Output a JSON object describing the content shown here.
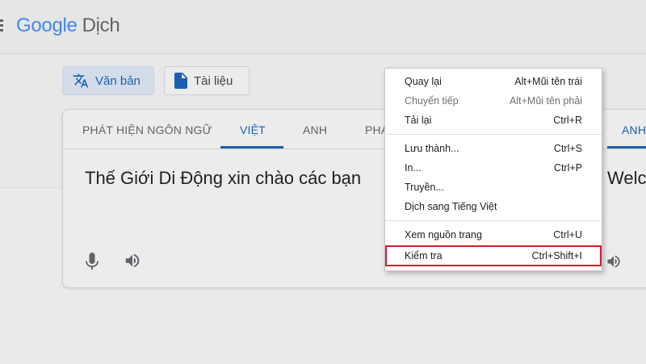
{
  "header": {
    "logo_google": "Google",
    "logo_product": "Dịch"
  },
  "modes": {
    "text_label": "Văn bản",
    "doc_label": "Tài liệu"
  },
  "source_langs": [
    "PHÁT HIỆN NGÔN NGỮ",
    "VIỆT",
    "ANH",
    "PHÁ"
  ],
  "target_lang_partial": "ANH",
  "source_text": "Thế Giới Di Động xin chào các bạn",
  "target_text_partial": "Welc",
  "context_menu": {
    "items": [
      {
        "label": "Quay lại",
        "shortcut": "Alt+Mũi tên trái"
      },
      {
        "label": "Chuyển tiếp",
        "shortcut": "Alt+Mũi tên phải"
      },
      {
        "label": "Tải lại",
        "shortcut": "Ctrl+R"
      },
      {
        "label": "Lưu thành...",
        "shortcut": "Ctrl+S"
      },
      {
        "label": "In...",
        "shortcut": "Ctrl+P"
      },
      {
        "label": "Truyền...",
        "shortcut": ""
      },
      {
        "label": "Dịch sang Tiếng Việt",
        "shortcut": ""
      },
      {
        "label": "Xem nguồn trang",
        "shortcut": "Ctrl+U"
      },
      {
        "label": "Kiểm tra",
        "shortcut": "Ctrl+Shift+I"
      }
    ]
  },
  "colors": {
    "accent": "#1a5fb4",
    "highlight_border": "#d81b2b"
  },
  "icons": [
    "menu-icon",
    "translate-icon",
    "document-icon",
    "microphone-icon",
    "speaker-icon"
  ]
}
